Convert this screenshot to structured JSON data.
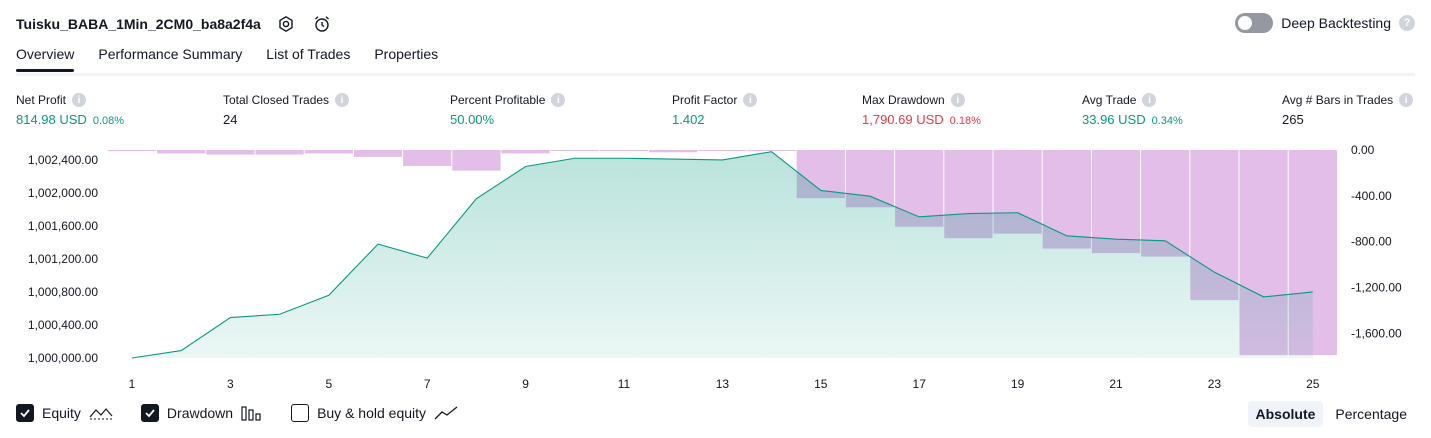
{
  "header": {
    "title": "Tuisku_BABA_1Min_2CM0_ba8a2f4a",
    "deep_backtesting_label": "Deep Backtesting",
    "help_glyph": "?"
  },
  "tabs": [
    {
      "label": "Overview",
      "active": true
    },
    {
      "label": "Performance Summary",
      "active": false
    },
    {
      "label": "List of Trades",
      "active": false
    },
    {
      "label": "Properties",
      "active": false
    }
  ],
  "metrics": [
    {
      "label": "Net Profit",
      "value": "814.98 USD",
      "pct": "0.08%",
      "color": "#089981"
    },
    {
      "label": "Total Closed Trades",
      "value": "24",
      "pct": "",
      "color": "#131722"
    },
    {
      "label": "Percent Profitable",
      "value": "50.00%",
      "pct": "",
      "color": "#089981"
    },
    {
      "label": "Profit Factor",
      "value": "1.402",
      "pct": "",
      "color": "#089981"
    },
    {
      "label": "Max Drawdown",
      "value": "1,790.69 USD",
      "pct": "0.18%",
      "color": "#f23645"
    },
    {
      "label": "Avg Trade",
      "value": "33.96 USD",
      "pct": "0.34%",
      "color": "#089981"
    },
    {
      "label": "Avg # Bars in Trades",
      "value": "265",
      "pct": "",
      "color": "#131722"
    }
  ],
  "chart_data": {
    "type": "area",
    "series": [
      {
        "name": "Equity",
        "axis": "left",
        "color": "#089981",
        "x": [
          1,
          2,
          3,
          4,
          5,
          6,
          7,
          8,
          9,
          10,
          11,
          12,
          13,
          14,
          15,
          16,
          17,
          18,
          19,
          20,
          21,
          22,
          23,
          24,
          25
        ],
        "values": [
          1000000,
          1000090,
          1000490,
          1000530,
          1000760,
          1001380,
          1001210,
          1001930,
          1002320,
          1002420,
          1002420,
          1002410,
          1002400,
          1002500,
          1002030,
          1001960,
          1001710,
          1001750,
          1001760,
          1001480,
          1001440,
          1001420,
          1001040,
          1000740,
          1000800
        ]
      },
      {
        "name": "Drawdown",
        "axis": "right",
        "type": "bar",
        "color": "#ce93d8",
        "x": [
          0,
          1,
          2,
          3,
          4,
          5,
          6,
          7,
          8,
          9,
          10,
          11,
          12,
          13,
          14,
          15,
          16,
          17,
          18,
          19,
          20,
          21,
          22,
          23,
          24,
          25
        ],
        "values": [
          0,
          -10,
          -30,
          -40,
          -40,
          -30,
          -60,
          -140,
          -180,
          -30,
          0,
          0,
          -20,
          0,
          0,
          -420,
          -500,
          -670,
          -770,
          -730,
          -860,
          -900,
          -930,
          -1310,
          -1790,
          -1790
        ]
      }
    ],
    "x_ticks": [
      "1",
      "3",
      "5",
      "7",
      "9",
      "11",
      "13",
      "15",
      "17",
      "19",
      "21",
      "23",
      "25"
    ],
    "y_left_ticks": [
      "1,000,000.00",
      "1,000,400.00",
      "1,000,800.00",
      "1,001,200.00",
      "1,001,600.00",
      "1,002,000.00",
      "1,002,400.00"
    ],
    "y_right_ticks": [
      "0.00",
      "-400.00",
      "-800.00",
      "-1,200.00",
      "-1,600.00"
    ],
    "y_left_range": [
      1000000,
      1002520
    ],
    "y_right_range": [
      -1815,
      0
    ]
  },
  "legend": {
    "equity": {
      "label": "Equity",
      "checked": true
    },
    "drawdown": {
      "label": "Drawdown",
      "checked": true
    },
    "buy_hold": {
      "label": "Buy & hold equity",
      "checked": false
    }
  },
  "mode": {
    "absolute": "Absolute",
    "percentage": "Percentage",
    "active": "absolute"
  }
}
